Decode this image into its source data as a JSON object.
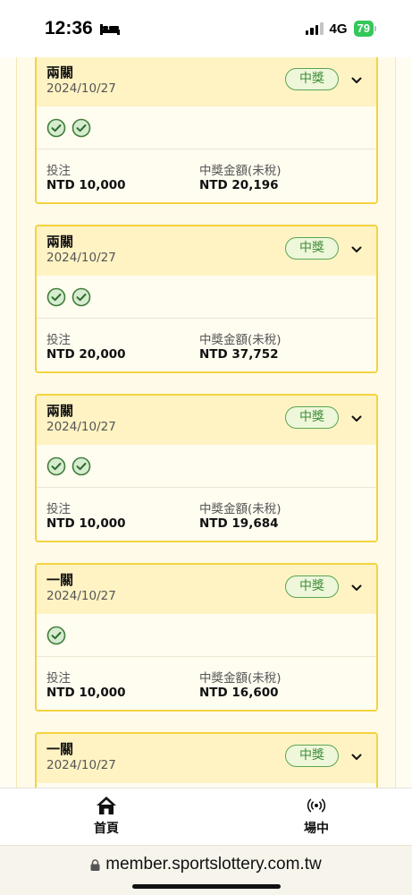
{
  "status_bar": {
    "time": "12:36",
    "network": "4G",
    "battery": "79"
  },
  "bets": [
    {
      "type": "兩關",
      "date": "2024/10/27",
      "status": "中獎",
      "selections": 2,
      "stake_label": "投注",
      "stake_value": "NTD 10,000",
      "payout_label": "中獎金額(未稅)",
      "payout_value": "NTD 20,196"
    },
    {
      "type": "兩關",
      "date": "2024/10/27",
      "status": "中獎",
      "selections": 2,
      "stake_label": "投注",
      "stake_value": "NTD 20,000",
      "payout_label": "中獎金額(未稅)",
      "payout_value": "NTD 37,752"
    },
    {
      "type": "兩關",
      "date": "2024/10/27",
      "status": "中獎",
      "selections": 2,
      "stake_label": "投注",
      "stake_value": "NTD 10,000",
      "payout_label": "中獎金額(未稅)",
      "payout_value": "NTD 19,684"
    },
    {
      "type": "一關",
      "date": "2024/10/27",
      "status": "中獎",
      "selections": 1,
      "stake_label": "投注",
      "stake_value": "NTD 10,000",
      "payout_label": "中獎金額(未稅)",
      "payout_value": "NTD 16,600"
    },
    {
      "type": "一關",
      "date": "2024/10/27",
      "status": "中獎"
    }
  ],
  "bottom_nav": {
    "home_label": "首頁",
    "live_label": "場中"
  },
  "url_bar": {
    "url": "member.sportslottery.com.tw"
  },
  "colors": {
    "card_border": "#f4d33f",
    "card_header": "#fff3c4",
    "win_green": "#3f8c3a"
  }
}
